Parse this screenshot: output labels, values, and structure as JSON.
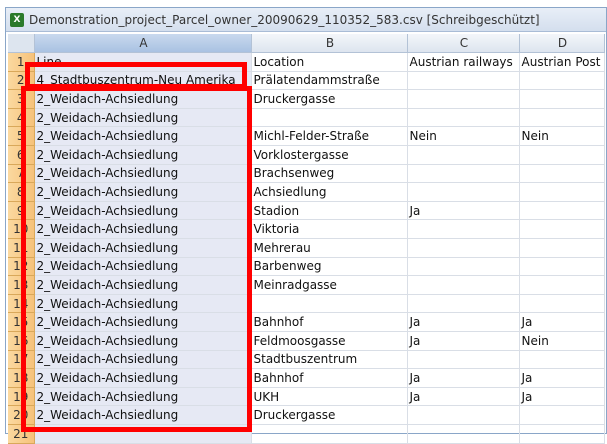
{
  "window": {
    "title": "Demonstration_project_Parcel_owner_20090629_110352_583.csv  [Schreibgeschützt]",
    "icon": "excel-icon"
  },
  "columns": [
    "A",
    "B",
    "C",
    "D"
  ],
  "rows": [
    {
      "n": "1",
      "a": "Line",
      "b": "Location",
      "c": "Austrian railways",
      "d": "Austrian Post"
    },
    {
      "n": "2",
      "a": "4_Stadtbuszentrum-Neu Amerika",
      "b": "Prälatendammstraße",
      "c": "",
      "d": ""
    },
    {
      "n": "3",
      "a": "2_Weidach-Achsiedlung",
      "b": "Druckergasse",
      "c": "",
      "d": ""
    },
    {
      "n": "4",
      "a": "2_Weidach-Achsiedlung",
      "b": "",
      "c": "",
      "d": ""
    },
    {
      "n": "5",
      "a": "2_Weidach-Achsiedlung",
      "b": "Michl-Felder-Straße",
      "c": "Nein",
      "d": "Nein"
    },
    {
      "n": "6",
      "a": "2_Weidach-Achsiedlung",
      "b": "Vorklostergasse",
      "c": "",
      "d": ""
    },
    {
      "n": "7",
      "a": "2_Weidach-Achsiedlung",
      "b": "Brachsenweg",
      "c": "",
      "d": ""
    },
    {
      "n": "8",
      "a": "2_Weidach-Achsiedlung",
      "b": "Achsiedlung",
      "c": "",
      "d": ""
    },
    {
      "n": "9",
      "a": "2_Weidach-Achsiedlung",
      "b": "Stadion",
      "c": "Ja",
      "d": ""
    },
    {
      "n": "10",
      "a": "2_Weidach-Achsiedlung",
      "b": "Viktoria",
      "c": "",
      "d": ""
    },
    {
      "n": "11",
      "a": "2_Weidach-Achsiedlung",
      "b": "Mehrerau",
      "c": "",
      "d": ""
    },
    {
      "n": "12",
      "a": "2_Weidach-Achsiedlung",
      "b": "Barbenweg",
      "c": "",
      "d": ""
    },
    {
      "n": "13",
      "a": "2_Weidach-Achsiedlung",
      "b": "Meinradgasse",
      "c": "",
      "d": ""
    },
    {
      "n": "14",
      "a": "2_Weidach-Achsiedlung",
      "b": "",
      "c": "",
      "d": ""
    },
    {
      "n": "15",
      "a": "2_Weidach-Achsiedlung",
      "b": "Bahnhof",
      "c": "Ja",
      "d": "Ja"
    },
    {
      "n": "16",
      "a": "2_Weidach-Achsiedlung",
      "b": "Feldmoosgasse",
      "c": "Ja",
      "d": "Nein"
    },
    {
      "n": "17",
      "a": "2_Weidach-Achsiedlung",
      "b": "Stadtbuszentrum",
      "c": "",
      "d": ""
    },
    {
      "n": "18",
      "a": "2_Weidach-Achsiedlung",
      "b": "Bahnhof",
      "c": "Ja",
      "d": "Ja"
    },
    {
      "n": "19",
      "a": "2_Weidach-Achsiedlung",
      "b": "UKH",
      "c": "Ja",
      "d": "Ja"
    },
    {
      "n": "20",
      "a": "2_Weidach-Achsiedlung",
      "b": "Druckergasse",
      "c": "",
      "d": ""
    },
    {
      "n": "21",
      "a": "",
      "b": "",
      "c": "",
      "d": ""
    }
  ],
  "highlight_color": "#ff0000"
}
